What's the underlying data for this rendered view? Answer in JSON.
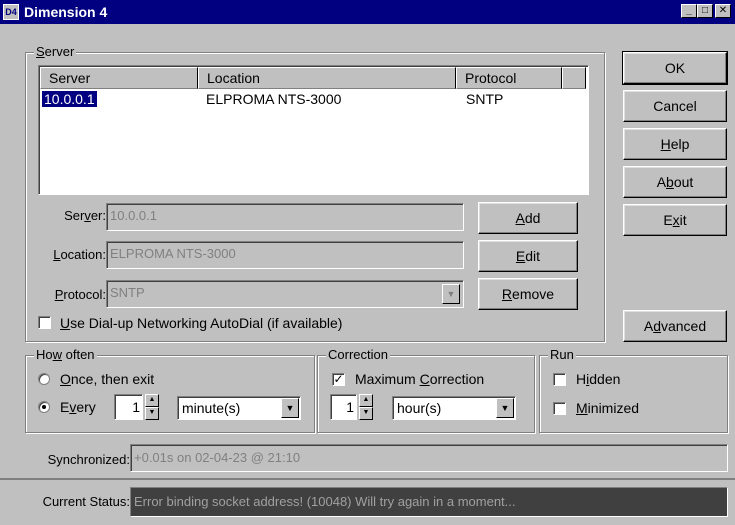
{
  "window": {
    "title": "Dimension 4",
    "buttons": {
      "minimize": "_",
      "maximize": "□",
      "close": "✕"
    }
  },
  "server_group": {
    "label": "Server",
    "columns": [
      "Server",
      "Location",
      "Protocol"
    ],
    "rows": [
      {
        "server": "10.0.0.1",
        "location": "ELPROMA NTS-3000",
        "protocol": "SNTP"
      }
    ],
    "server_label": "Server:",
    "server_value": "10.0.0.1",
    "location_label": "Location:",
    "location_value": "ELPROMA NTS-3000",
    "protocol_label": "Protocol:",
    "protocol_value": "SNTP",
    "dialup_label": "Use Dial-up Networking AutoDial (if available)",
    "dialup_checked": false,
    "add_label": "Add",
    "edit_label": "Edit",
    "remove_label": "Remove"
  },
  "right_buttons": {
    "ok": "OK",
    "cancel": "Cancel",
    "help": "Help",
    "about": "About",
    "exit": "Exit",
    "advanced": "Advanced"
  },
  "how_often": {
    "label": "How often",
    "once_label": "Once, then exit",
    "every_label": "Every",
    "selected": "every",
    "every_value": "1",
    "unit": "minute(s)"
  },
  "correction": {
    "label": "Correction",
    "max_label": "Maximum Correction",
    "max_checked": true,
    "value": "1",
    "unit": "hour(s)"
  },
  "run": {
    "label": "Run",
    "hidden_label": "Hidden",
    "hidden_checked": false,
    "minimized_label": "Minimized",
    "minimized_checked": false
  },
  "status": {
    "synchronized_label": "Synchronized:",
    "synchronized_value": "+0.01s on 02-04-23 @ 21:10",
    "current_label": "Current Status:",
    "current_value": "Error binding socket address! (10048) Will try again in a moment..."
  },
  "colors": {
    "titlebar": "#000080",
    "face": "#c0c0c0",
    "status_bg": "#404040"
  }
}
